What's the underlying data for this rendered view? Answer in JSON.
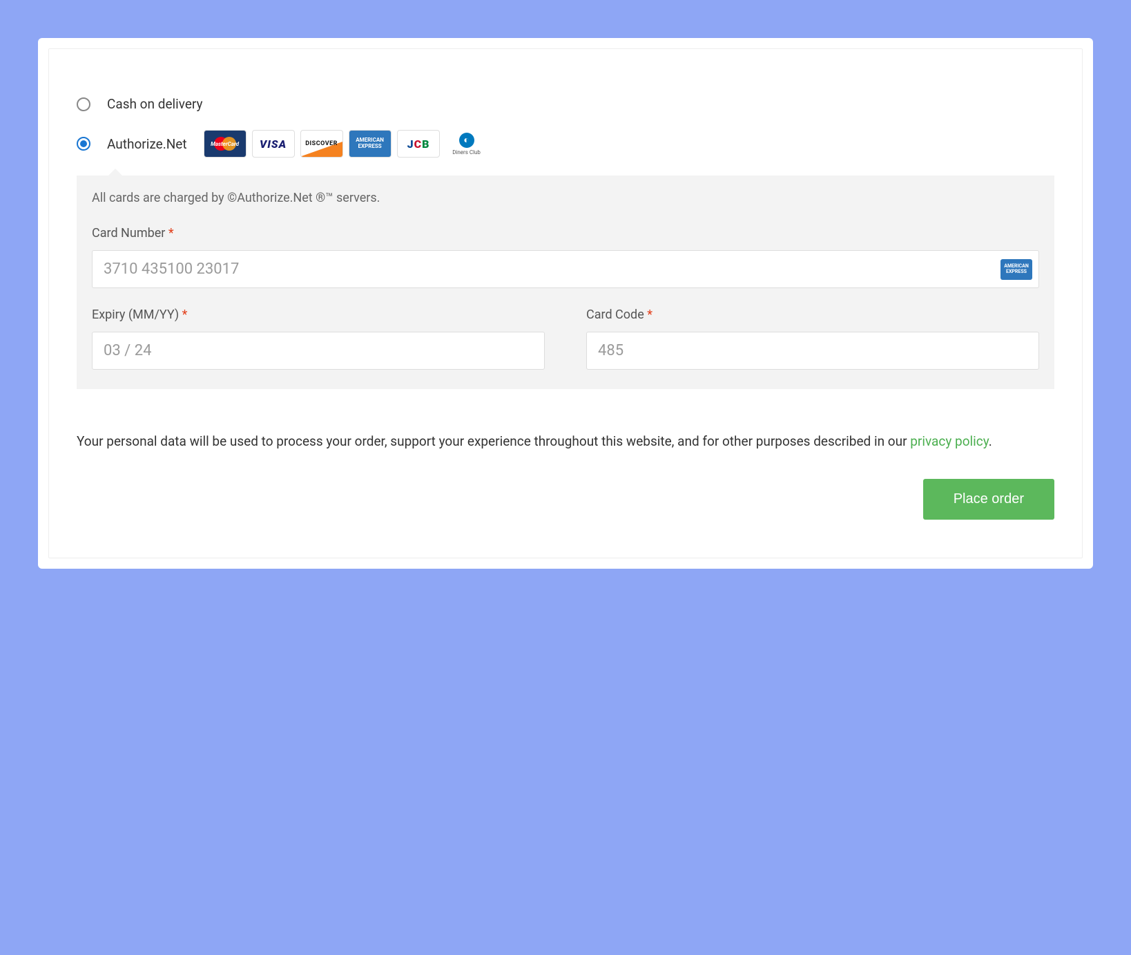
{
  "payment_methods": {
    "cod": {
      "label": "Cash on delivery"
    },
    "authnet": {
      "label": "Authorize.Net",
      "cards": [
        "MasterCard",
        "VISA",
        "DISCOVER",
        "AMERICAN EXPRESS",
        "JCB",
        "Diners Club"
      ]
    }
  },
  "selected_method": "authnet",
  "details": {
    "info_text": "All cards are charged by ©Authorize.Net ®™ servers.",
    "card_number": {
      "label": "Card Number",
      "value": "3710 435100 23017",
      "detected_brand": "AMERICAN EXPRESS"
    },
    "expiry": {
      "label": "Expiry (MM/YY)",
      "value": "03 / 24"
    },
    "card_code": {
      "label": "Card Code",
      "value": "485"
    }
  },
  "disclaimer": {
    "text_before": "Your personal data will be used to process your order, support your experience throughout this website, and for other purposes described in our ",
    "link_text": "privacy policy",
    "text_after": "."
  },
  "actions": {
    "place_order": "Place order"
  }
}
